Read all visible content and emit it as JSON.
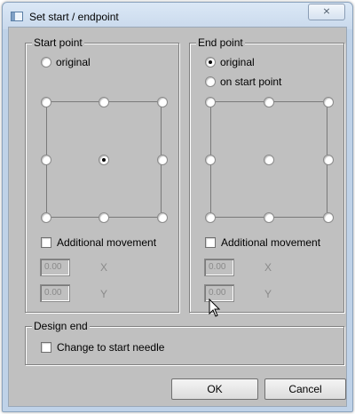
{
  "window": {
    "title": "Set start / endpoint",
    "close_symbol": "⨯"
  },
  "start_point": {
    "group_label": "Start point",
    "original_label": "original",
    "original_selected": false,
    "grid_selected": "center",
    "additional_movement_label": "Additional movement",
    "additional_movement_checked": false,
    "x_value": "0.00",
    "x_label": "X",
    "y_value": "0.00",
    "y_label": "Y"
  },
  "end_point": {
    "group_label": "End point",
    "original_label": "original",
    "original_selected": true,
    "on_start_point_label": "on start point",
    "on_start_point_selected": false,
    "grid_selected": "none",
    "additional_movement_label": "Additional movement",
    "additional_movement_checked": false,
    "x_value": "0.00",
    "x_label": "X",
    "y_value": "0.00",
    "y_label": "Y"
  },
  "design_end": {
    "group_label": "Design end",
    "change_to_start_needle_label": "Change to start needle",
    "change_to_start_needle_checked": false
  },
  "buttons": {
    "ok_label": "OK",
    "cancel_label": "Cancel"
  },
  "colors": {
    "dialog_background": "#c0c0c0",
    "titlebar": "#c9d9ec",
    "disabled_text": "#8a8a8a"
  }
}
